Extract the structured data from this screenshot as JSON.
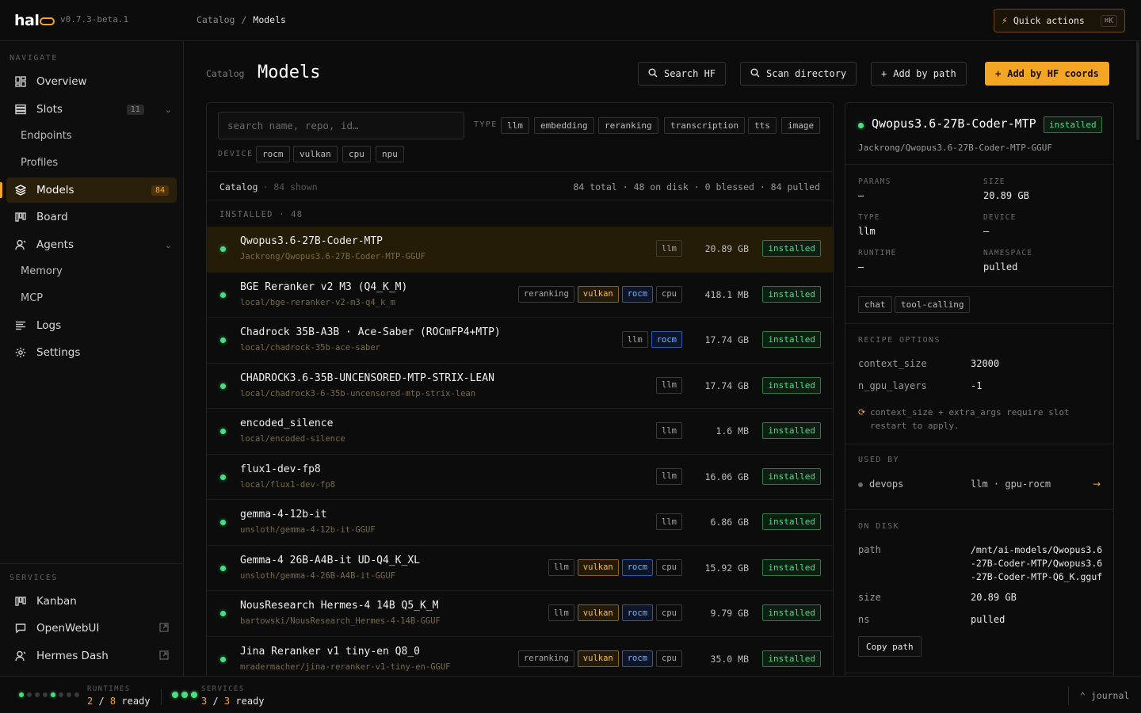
{
  "app": {
    "version": "v0.7.3-beta.1",
    "breadcrumb": [
      "Catalog",
      "/",
      "Models"
    ],
    "quick_actions": {
      "label": "Quick actions",
      "shortcut": "⌘K"
    }
  },
  "sidebar": {
    "navigate_label": "NAVIGATE",
    "items": [
      {
        "label": "Overview",
        "icon": "overview-icon"
      },
      {
        "label": "Slots",
        "icon": "slots-icon",
        "badge": "11"
      },
      {
        "label": "Endpoints"
      },
      {
        "label": "Profiles"
      },
      {
        "label": "Models",
        "icon": "models-icon",
        "badge": "84"
      },
      {
        "label": "Board",
        "icon": "board-icon"
      },
      {
        "label": "Agents",
        "icon": "agents-icon"
      },
      {
        "label": "Memory"
      },
      {
        "label": "MCP"
      },
      {
        "label": "Logs",
        "icon": "logs-icon"
      },
      {
        "label": "Settings",
        "icon": "settings-icon"
      }
    ],
    "services_label": "SERVICES",
    "services": [
      {
        "label": "Kanban",
        "icon": "kanban-icon"
      },
      {
        "label": "OpenWebUI",
        "icon": "chat-icon"
      },
      {
        "label": "Hermes Dash",
        "icon": "hermes-icon"
      }
    ]
  },
  "main": {
    "kicker": "Catalog",
    "title": "Models",
    "buttons": {
      "search_hf": "Search HF",
      "scan_dir": "Scan directory",
      "add_path": "Add by path",
      "add_hf": "Add by HF coords"
    },
    "filters": {
      "search_placeholder": "search name, repo, id…",
      "type_label": "TYPE",
      "types": [
        "llm",
        "embedding",
        "reranking",
        "transcription",
        "tts",
        "image"
      ],
      "device_label": "DEVICE",
      "devices": [
        "rocm",
        "vulkan",
        "cpu",
        "npu"
      ]
    },
    "summary": {
      "left": "Catalog",
      "shown": "· 84 shown",
      "right": "84 total · 48 on disk · 0 blessed · 84 pulled"
    },
    "group_label": "INSTALLED · 48",
    "rows": [
      {
        "name": "Qwopus3.6-27B-Coder-MTP",
        "repo": "Jackrong/Qwopus3.6-27B-Coder-MTP-GGUF",
        "tags": [
          "llm"
        ],
        "size": "20.89 GB",
        "status": "installed"
      },
      {
        "name": "BGE Reranker v2 M3 (Q4_K_M)",
        "repo": "local/bge-reranker-v2-m3-q4_k_m",
        "tags": [
          "reranking",
          "vulkan",
          "rocm",
          "cpu"
        ],
        "size": "418.1 MB",
        "status": "installed"
      },
      {
        "name": "Chadrock 35B-A3B · Ace-Saber (ROCmFP4+MTP)",
        "repo": "local/chadrock-35b-ace-saber",
        "tags": [
          "llm",
          "rocm"
        ],
        "size": "17.74 GB",
        "status": "installed"
      },
      {
        "name": "CHADROCK3.6-35B-UNCENSORED-MTP-STRIX-LEAN",
        "repo": "local/chadrock3-6-35b-uncensored-mtp-strix-lean",
        "tags": [
          "llm"
        ],
        "size": "17.74 GB",
        "status": "installed"
      },
      {
        "name": "encoded_silence",
        "repo": "local/encoded-silence",
        "tags": [
          "llm"
        ],
        "size": "1.6 MB",
        "status": "installed"
      },
      {
        "name": "flux1-dev-fp8",
        "repo": "local/flux1-dev-fp8",
        "tags": [
          "llm"
        ],
        "size": "16.06 GB",
        "status": "installed"
      },
      {
        "name": "gemma-4-12b-it",
        "repo": "unsloth/gemma-4-12b-it-GGUF",
        "tags": [
          "llm"
        ],
        "size": "6.86 GB",
        "status": "installed"
      },
      {
        "name": "Gemma-4 26B-A4B-it UD-Q4_K_XL",
        "repo": "unsloth/gemma-4-26B-A4B-it-GGUF",
        "tags": [
          "llm",
          "vulkan",
          "rocm",
          "cpu"
        ],
        "size": "15.92 GB",
        "status": "installed"
      },
      {
        "name": "NousResearch Hermes-4 14B Q5_K_M",
        "repo": "bartowski/NousResearch_Hermes-4-14B-GGUF",
        "tags": [
          "llm",
          "vulkan",
          "rocm",
          "cpu"
        ],
        "size": "9.79 GB",
        "status": "installed"
      },
      {
        "name": "Jina Reranker v1 tiny-en Q8_0",
        "repo": "mradermacher/jina-reranker-v1-tiny-en-GGUF",
        "tags": [
          "reranking",
          "vulkan",
          "rocm",
          "cpu"
        ],
        "size": "35.0 MB",
        "status": "installed"
      }
    ]
  },
  "detail": {
    "title": "Qwopus3.6-27B-Coder-MTP",
    "status": "installed",
    "repo": "Jackrong/Qwopus3.6-27B-Coder-MTP-GGUF",
    "props": {
      "params_label": "PARAMS",
      "params": "—",
      "size_label": "SIZE",
      "size": "20.89 GB",
      "type_label": "TYPE",
      "type": "llm",
      "device_label": "DEVICE",
      "device": "—",
      "runtime_label": "RUNTIME",
      "runtime": "—",
      "namespace_label": "NAMESPACE",
      "namespace": "pulled"
    },
    "capabilities": [
      "chat",
      "tool-calling"
    ],
    "recipe_label": "RECIPE OPTIONS",
    "recipe": [
      {
        "key": "context_size",
        "value": "32000"
      },
      {
        "key": "n_gpu_layers",
        "value": "-1"
      }
    ],
    "note": "context_size + extra_args require slot restart to apply.",
    "used_by_label": "USED BY",
    "used_by": {
      "name": "devops",
      "desc": "llm · gpu-rocm",
      "arrow": "→"
    },
    "on_disk_label": "ON DISK",
    "on_disk": {
      "path_key": "path",
      "path": "/mnt/ai-models/Qwopus3.6-27B-Coder-MTP/Qwopus3.6-27B-Coder-MTP-Q6_K.gguf",
      "size_key": "size",
      "size": "20.89 GB",
      "ns_key": "ns",
      "ns": "pulled"
    },
    "copy_label": "Copy path"
  },
  "status": {
    "runtimes_label": "RUNTIMES",
    "runtimes_ready": "2",
    "runtimes_total": "8",
    "runtimes_state": [
      1,
      0,
      0,
      0,
      1,
      0,
      0,
      0
    ],
    "services_label": "SERVICES",
    "services_ready": "3",
    "services_total": "3",
    "ready_word": "ready",
    "journal": "⌃ journal"
  },
  "colors": {
    "accent": "#f5a524",
    "ok": "#4ade80",
    "rocm": "#7fb0ff"
  }
}
